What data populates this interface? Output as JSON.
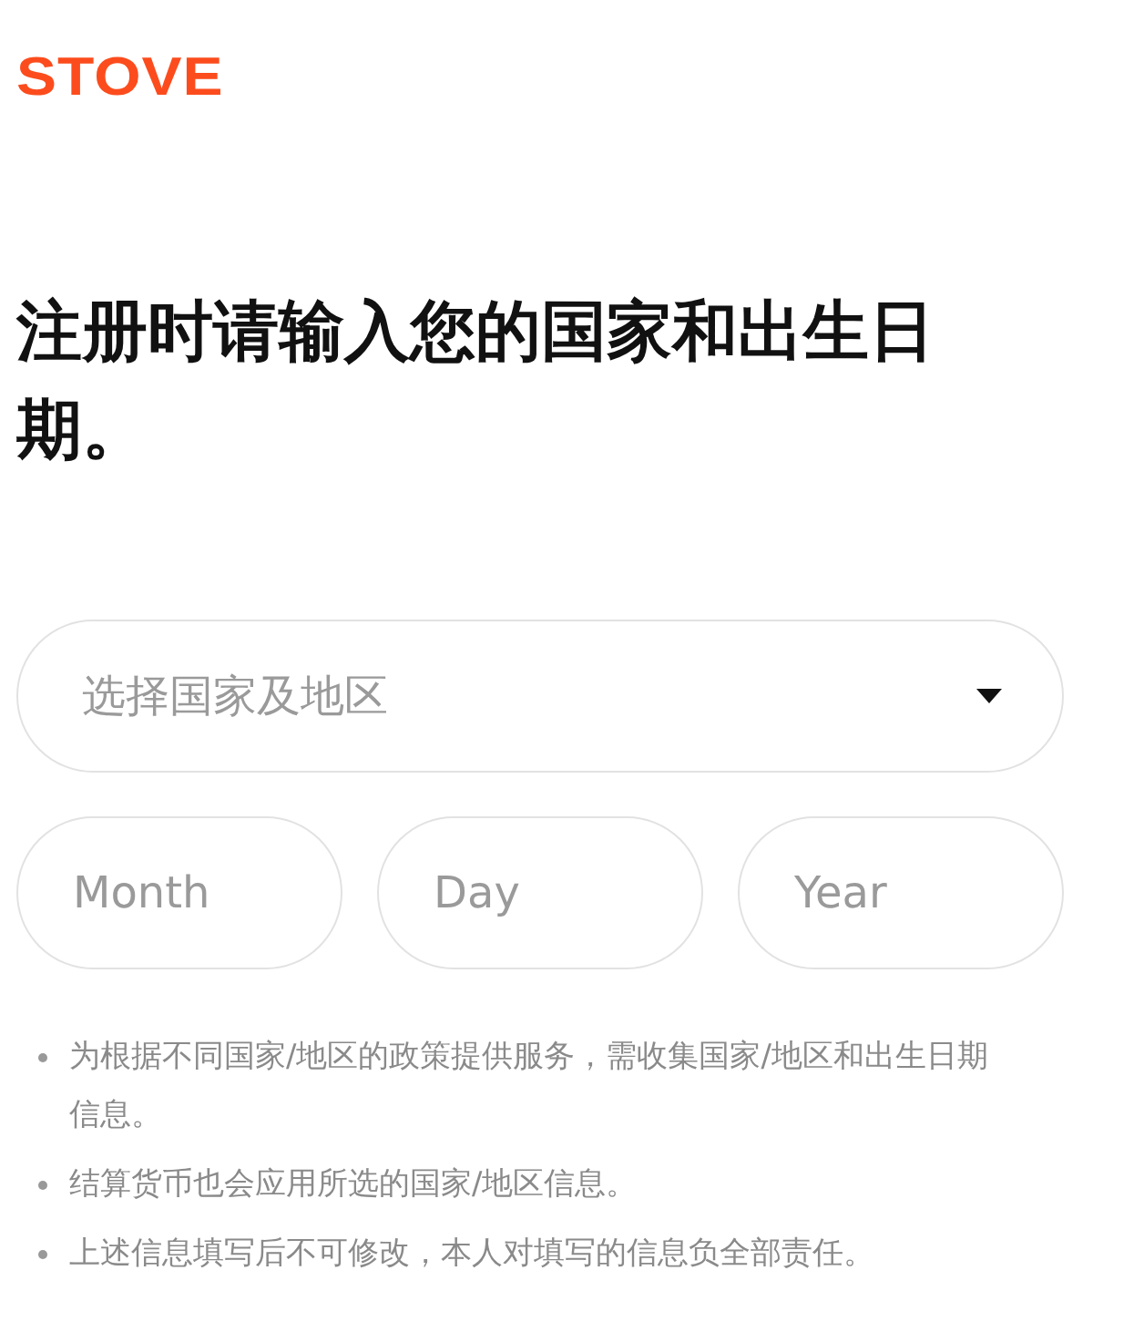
{
  "logo": "STOVE",
  "heading": "注册时请输入您的国家和出生日期。",
  "country_select": {
    "placeholder": "选择国家及地区"
  },
  "date_fields": [
    {
      "placeholder": "Month"
    },
    {
      "placeholder": "Day"
    },
    {
      "placeholder": "Year"
    }
  ],
  "notes": [
    "为根据不同国家/地区的政策提供服务，需收集国家/地区和出生日期信息。",
    "结算货币也会应用所选的国家/地区信息。",
    "上述信息填写后不可修改，本人对填写的信息负全部责任。"
  ]
}
